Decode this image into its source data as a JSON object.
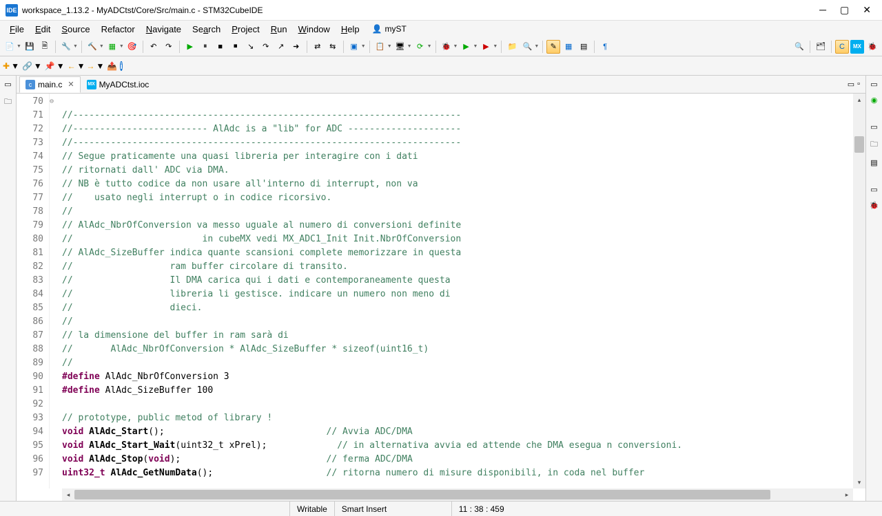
{
  "title": "workspace_1.13.2 - MyADCtst/Core/Src/main.c - STM32CubeIDE",
  "ideBadge": "IDE",
  "menu": {
    "file": "File",
    "edit": "Edit",
    "source": "Source",
    "refactor": "Refactor",
    "navigate": "Navigate",
    "search": "Search",
    "project": "Project",
    "run": "Run",
    "window": "Window",
    "help": "Help",
    "myst": "myST"
  },
  "tabs": {
    "main": "main.c",
    "ioc": "MyADCtst.ioc"
  },
  "status": {
    "writable": "Writable",
    "insert": "Smart Insert",
    "pos": "11 : 38 : 459"
  },
  "lines": {
    "start": 70,
    "marks": {
      "71": "⊖"
    },
    "code": [
      {
        "t": "c",
        "s": ""
      },
      {
        "t": "c",
        "s": "//------------------------------------------------------------------------"
      },
      {
        "t": "c",
        "s": "//------------------------- AlAdc is a \"lib\" for ADC ---------------------"
      },
      {
        "t": "c",
        "s": "//------------------------------------------------------------------------"
      },
      {
        "t": "c",
        "s": "// Segue praticamente una quasi libreria per interagire con i dati"
      },
      {
        "t": "c",
        "s": "// ritornati dall' ADC via DMA."
      },
      {
        "t": "c",
        "s": "// NB è tutto codice da non usare all'interno di interrupt, non va"
      },
      {
        "t": "c",
        "s": "//    usato negli interrupt o in codice ricorsivo."
      },
      {
        "t": "c",
        "s": "//"
      },
      {
        "t": "c",
        "s": "// AlAdc_NbrOfConversion va messo uguale al numero di conversioni definite"
      },
      {
        "t": "c",
        "s": "//                        in cubeMX vedi MX_ADC1_Init Init.NbrOfConversion"
      },
      {
        "t": "c",
        "s": "// AlAdc_SizeBuffer indica quante scansioni complete memorizzare in questa"
      },
      {
        "t": "c",
        "s": "//                  ram buffer circolare di transito."
      },
      {
        "t": "c",
        "s": "//                  Il DMA carica qui i dati e contemporaneamente questa"
      },
      {
        "t": "c",
        "s": "//                  libreria li gestisce. indicare un numero non meno di"
      },
      {
        "t": "c",
        "s": "//                  dieci."
      },
      {
        "t": "c",
        "s": "//"
      },
      {
        "t": "c",
        "s": "// la dimensione del buffer in ram sarà di"
      },
      {
        "t": "c",
        "s": "//       AlAdc_NbrOfConversion * AlAdc_SizeBuffer * sizeof(uint16_t)"
      },
      {
        "t": "c",
        "s": "//"
      },
      {
        "t": "d",
        "kw": "#define",
        "rest": " AlAdc_NbrOfConversion 3"
      },
      {
        "t": "d",
        "kw": "#define",
        "rest": " AlAdc_SizeBuffer 100"
      },
      {
        "t": "p",
        "s": ""
      },
      {
        "t": "c",
        "s": "// prototype, public metod of library !"
      },
      {
        "t": "f",
        "kw": "void ",
        "fn": "AlAdc_Start",
        "args": "();",
        "pad": "                              ",
        "cm": "// Avvia ADC/DMA"
      },
      {
        "t": "f",
        "kw": "void ",
        "fn": "AlAdc_Start_Wait",
        "args": "(uint32_t xPrel);",
        "pad": "             ",
        "cm": "// in alternativa avvia ed attende che DMA esegua n conversioni."
      },
      {
        "t": "f",
        "kw": "void ",
        "fn": "AlAdc_Stop",
        "args": "(",
        "a2kw": "void",
        "a2rest": ");",
        "pad": "                           ",
        "cm": "// ferma ADC/DMA"
      },
      {
        "t": "f",
        "kw": "uint32_t ",
        "fn": "AlAdc_GetNumData",
        "args": "();",
        "pad": "                     ",
        "cm": "// ritorna numero di misure disponibili, in coda nel buffer"
      }
    ]
  }
}
